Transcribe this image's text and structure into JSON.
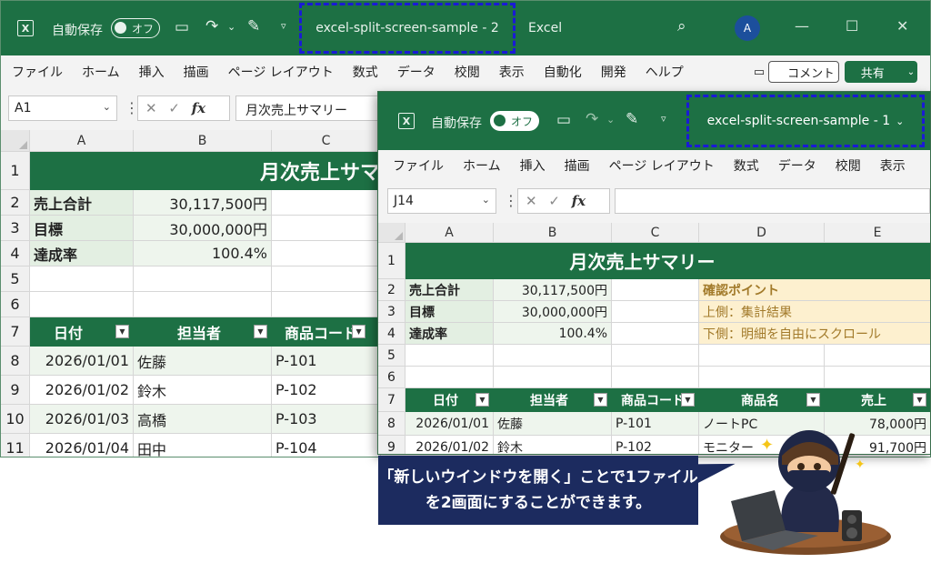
{
  "back_window": {
    "autosave_label": "自動保存",
    "toggle_label": "オフ",
    "title": "excel-split-screen-sample - 2",
    "app_name": "Excel",
    "avatar_initial": "A",
    "menu": [
      "ファイル",
      "ホーム",
      "挿入",
      "描画",
      "ページ レイアウト",
      "数式",
      "データ",
      "校閲",
      "表示",
      "自動化",
      "開発",
      "ヘルプ"
    ],
    "comment_label": "コメント",
    "share_label": "共有",
    "name_box": "A1",
    "formula": "月次売上サマリー",
    "col_headers": [
      "A",
      "B",
      "C"
    ],
    "rows": {
      "r1": {
        "num": "1",
        "title": "月次売上サマ"
      },
      "r2": {
        "num": "2",
        "a": "売上合計",
        "b": "30,117,500円"
      },
      "r3": {
        "num": "3",
        "a": "目標",
        "b": "30,000,000円"
      },
      "r4": {
        "num": "4",
        "a": "達成率",
        "b": "100.4%"
      },
      "r5": {
        "num": "5"
      },
      "r6": {
        "num": "6"
      },
      "r7": {
        "num": "7",
        "a": "日付",
        "b": "担当者",
        "c": "商品コード"
      },
      "r8": {
        "num": "8",
        "a": "2026/01/01",
        "b": "佐藤",
        "c": "P-101"
      },
      "r9": {
        "num": "9",
        "a": "2026/01/02",
        "b": "鈴木",
        "c": "P-102"
      },
      "r10": {
        "num": "10",
        "a": "2026/01/03",
        "b": "高橋",
        "c": "P-103"
      },
      "r11": {
        "num": "11",
        "a": "2026/01/04",
        "b": "田中",
        "c": "P-104"
      }
    }
  },
  "front_window": {
    "autosave_label": "自動保存",
    "toggle_label": "オフ",
    "title": "excel-split-screen-sample - 1",
    "menu": [
      "ファイル",
      "ホーム",
      "挿入",
      "描画",
      "ページ レイアウト",
      "数式",
      "データ",
      "校閲",
      "表示"
    ],
    "name_box": "J14",
    "formula": "",
    "col_headers": [
      "A",
      "B",
      "C",
      "D",
      "E"
    ],
    "rows": {
      "r1": {
        "num": "1",
        "title": "月次売上サマリー"
      },
      "r2": {
        "num": "2",
        "a": "売上合計",
        "b": "30,117,500円",
        "d": "確認ポイント"
      },
      "r3": {
        "num": "3",
        "a": "目標",
        "b": "30,000,000円",
        "d": "上側：集計結果"
      },
      "r4": {
        "num": "4",
        "a": "達成率",
        "b": "100.4%",
        "d": "下側：明細を自由にスクロール"
      },
      "r5": {
        "num": "5"
      },
      "r6": {
        "num": "6"
      },
      "r7": {
        "num": "7",
        "a": "日付",
        "b": "担当者",
        "c": "商品コード",
        "d": "商品名",
        "e": "売上"
      },
      "r8": {
        "num": "8",
        "a": "2026/01/01",
        "b": "佐藤",
        "c": "P-101",
        "d": "ノートPC",
        "e": "78,000円"
      },
      "r9": {
        "num": "9",
        "a": "2026/01/02",
        "b": "鈴木",
        "c": "P-102",
        "d": "モニター",
        "e": "91,700円"
      }
    }
  },
  "callout": {
    "line1": "「新しいウインドウを開く」ことで1ファイル",
    "line2": "を2画面にすることができます。"
  },
  "colors": {
    "excel_green": "#1d7044",
    "highlight_border": "#1a1ad6",
    "callout_bg": "#1c2b5f"
  }
}
